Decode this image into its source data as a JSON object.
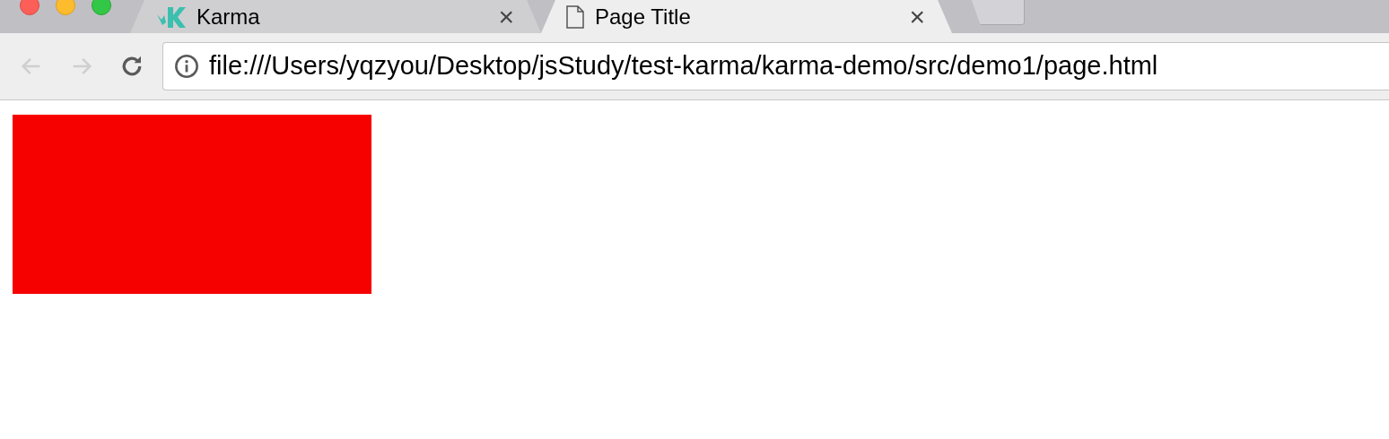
{
  "tabs": [
    {
      "kind": "karma",
      "title": "Karma",
      "close": "×",
      "selected": false
    },
    {
      "kind": "page",
      "title": "Page Title",
      "close": "×",
      "selected": true
    }
  ],
  "toolbar": {
    "back_disabled": true,
    "forward_disabled": true,
    "url": "file:///Users/yqzyou/Desktop/jsStudy/test-karma/karma-demo/src/demo1/page.html"
  }
}
